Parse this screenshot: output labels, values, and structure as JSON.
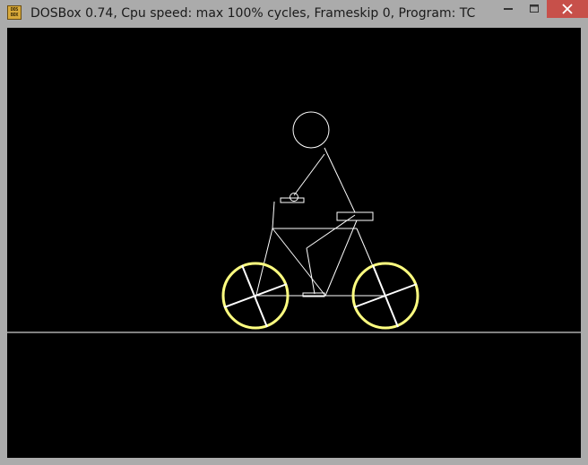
{
  "window": {
    "title": "DOSBox 0.74, Cpu speed: max 100% cycles, Frameskip  0, Program:      TC",
    "icon": {
      "name": "dosbox-icon",
      "text": "DOS BOX"
    },
    "controls": {
      "minimize": {
        "icon": "minimize-icon"
      },
      "maximize": {
        "icon": "maximize-icon"
      },
      "close": {
        "icon": "close-icon",
        "color": "#c7504a"
      }
    }
  },
  "scene": {
    "background": "#000000",
    "line_color": "#ffffff",
    "wheel_color": "#ffff80",
    "description_items": [
      "ground-line",
      "rider",
      "bicycle"
    ]
  }
}
